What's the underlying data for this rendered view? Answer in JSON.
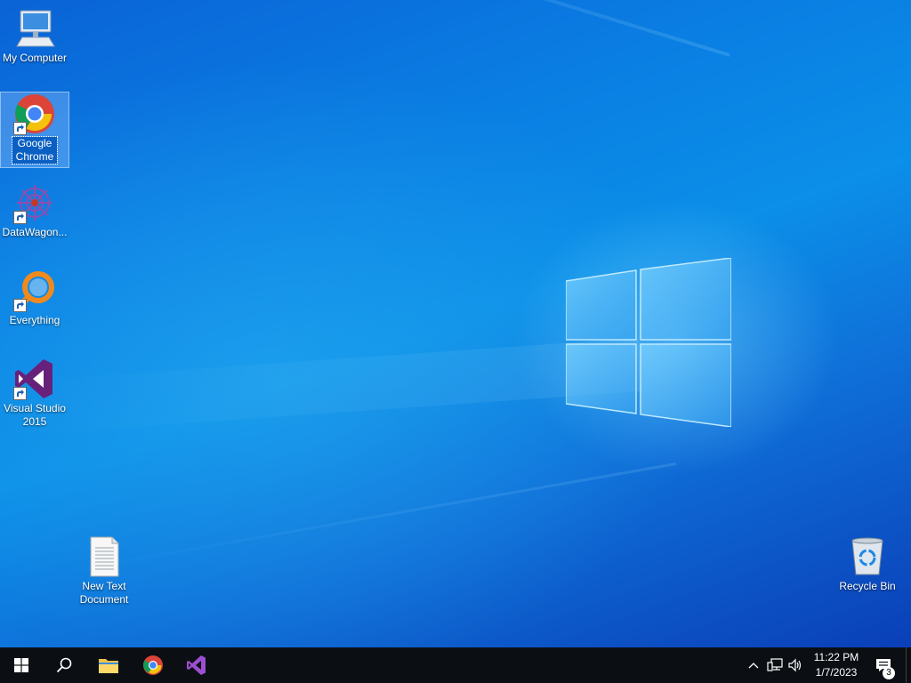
{
  "desktop": {
    "icons": [
      {
        "label": "My Computer"
      },
      {
        "label": "Google Chrome"
      },
      {
        "label": "DataWagon..."
      },
      {
        "label": "Everything"
      },
      {
        "label": "Visual Studio 2015"
      },
      {
        "label": "New Text Document"
      },
      {
        "label": "Recycle Bin"
      }
    ]
  },
  "taskbar": {
    "start_icon": "windows-start-icon",
    "search_icon": "search-icon",
    "pinned": [
      "file-explorer-icon",
      "chrome-icon",
      "visual-studio-icon"
    ],
    "tray_icons": [
      "chevron-up-icon",
      "network-icon",
      "volume-icon"
    ],
    "clock": {
      "time": "11:22 PM",
      "date": "1/7/2023"
    },
    "notifications": {
      "count": "3"
    }
  },
  "colors": {
    "taskbar": "#0b0f14",
    "accent": "#0a7fe3"
  }
}
